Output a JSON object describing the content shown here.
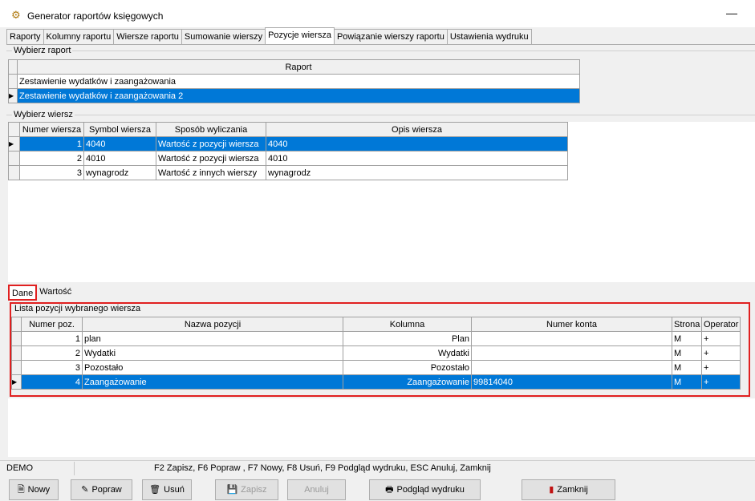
{
  "window": {
    "title": "Generator raportów księgowych",
    "minimize": "—"
  },
  "tabs": [
    {
      "label": "Raporty"
    },
    {
      "label": "Kolumny raportu"
    },
    {
      "label": "Wiersze raportu"
    },
    {
      "label": "Sumowanie wierszy"
    },
    {
      "label": "Pozycje wiersza",
      "active": true
    },
    {
      "label": "Powiązanie wierszy raportu"
    },
    {
      "label": "Ustawienia wydruku"
    }
  ],
  "report_group": {
    "title": "Wybierz raport",
    "column": "Raport",
    "rows": [
      "Zestawienie wydatków i zaangażowania",
      "Zestawienie wydatków i zaangażowania 2"
    ],
    "selected_index": 1
  },
  "row_group": {
    "title": "Wybierz wiersz",
    "columns": [
      "Numer wiersza",
      "Symbol wiersza",
      "Sposób wyliczania",
      "Opis wiersza"
    ],
    "rows": [
      [
        "1",
        "4040",
        "Wartość z pozycji wiersza",
        "4040"
      ],
      [
        "2",
        "4010",
        "Wartość z pozycji wiersza",
        "4010"
      ],
      [
        "3",
        "wynagrodz",
        "Wartość z innych wierszy",
        "wynagrodz"
      ]
    ],
    "selected_index": 0
  },
  "lower_tabs": [
    "Dane",
    "Wartość"
  ],
  "positions_group": {
    "title": "Lista pozycji wybranego wiersza",
    "columns": [
      "Numer poz.",
      "Nazwa pozycji",
      "Kolumna",
      "Numer konta",
      "Strona",
      "Operator"
    ],
    "rows": [
      [
        "1",
        "plan",
        "Plan",
        "",
        "M",
        "+"
      ],
      [
        "2",
        "Wydatki",
        "Wydatki",
        "",
        "M",
        "+"
      ],
      [
        "3",
        "Pozostało",
        "Pozostało",
        "",
        "M",
        "+"
      ],
      [
        "4",
        "Zaangażowanie",
        "Zaangażowanie",
        "99814040",
        "M",
        "+"
      ]
    ],
    "selected_index": 3
  },
  "status": {
    "left": "DEMO",
    "keys": "F2 Zapisz, F6 Popraw , F7 Nowy, F8 Usuń, F9 Podgląd wydruku, ESC Anuluj, Zamknij"
  },
  "buttons": {
    "new": "Nowy",
    "edit": "Popraw",
    "delete": "Usuń",
    "save": "Zapisz",
    "cancel": "Anuluj",
    "preview": "Podgląd wydruku",
    "close": "Zamknij"
  },
  "icons": {
    "app": "gear-icon",
    "new": "new-document-icon",
    "edit": "edit-icon",
    "delete": "trash-icon",
    "save": "floppy-disk-icon",
    "preview": "printer-icon",
    "close": "exit-door-icon",
    "row_pointer": "row-pointer-icon"
  },
  "colors": {
    "selection": "#0078d7",
    "highlight_box": "#e02020"
  }
}
